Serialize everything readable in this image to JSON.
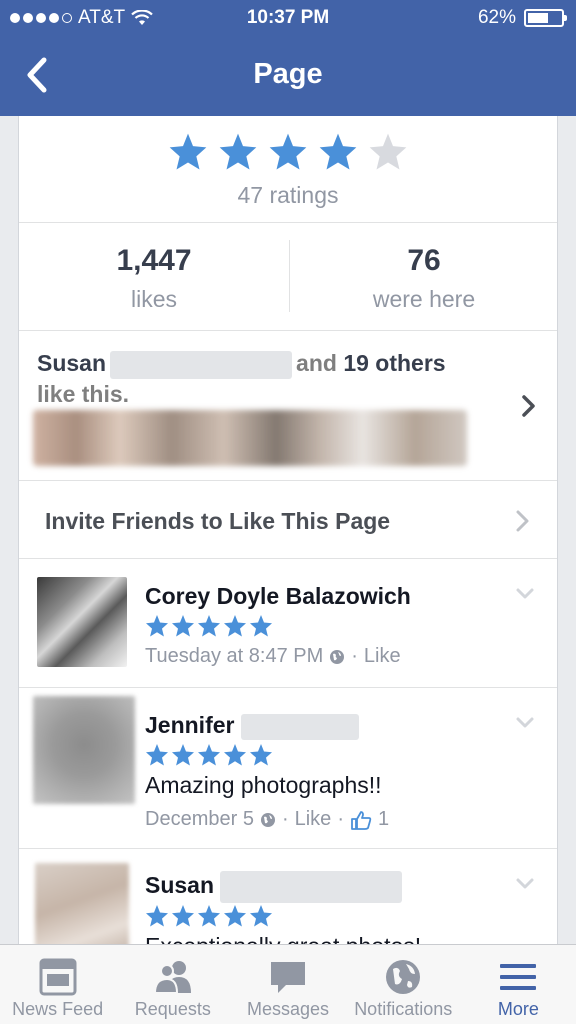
{
  "status_bar": {
    "carrier": "AT&T",
    "time": "10:37 PM",
    "battery": "62%",
    "battery_level": 0.62
  },
  "nav": {
    "title": "Page",
    "back_icon": "chevron-left-icon"
  },
  "rating": {
    "stars": 4,
    "max_stars": 5,
    "count_label": "47 ratings"
  },
  "stats": [
    {
      "value": "1,447",
      "label": "likes"
    },
    {
      "value": "76",
      "label": "were here"
    }
  ],
  "friends_like": {
    "first_name": "Susan",
    "middle": "and",
    "count": "19 others",
    "suffix": "like this."
  },
  "invite": {
    "label": "Invite Friends to Like This Page"
  },
  "reviews": [
    {
      "name": "Corey Doyle Balazowich",
      "stars": 5,
      "text": "",
      "time": "Tuesday at 8:47 PM",
      "like_label": "Like",
      "like_count": ""
    },
    {
      "name": "Jennifer",
      "stars": 5,
      "text": "Amazing photographs!!",
      "time": "December 5",
      "like_label": "Like",
      "like_count": "1"
    },
    {
      "name": "Susan",
      "stars": 5,
      "text": "Exceptionally great photos!",
      "time": "",
      "like_label": "",
      "like_count": ""
    }
  ],
  "tabs": [
    {
      "label": "News Feed",
      "icon": "news-feed-icon",
      "active": false
    },
    {
      "label": "Requests",
      "icon": "friend-requests-icon",
      "active": false
    },
    {
      "label": "Messages",
      "icon": "messages-icon",
      "active": false
    },
    {
      "label": "Notifications",
      "icon": "globe-icon",
      "active": false
    },
    {
      "label": "More",
      "icon": "hamburger-menu-icon",
      "active": true
    }
  ],
  "colors": {
    "header": "#4263a8",
    "star": "#4a90d9",
    "star_empty": "#d8dadf",
    "active_tab": "#4263a8"
  }
}
